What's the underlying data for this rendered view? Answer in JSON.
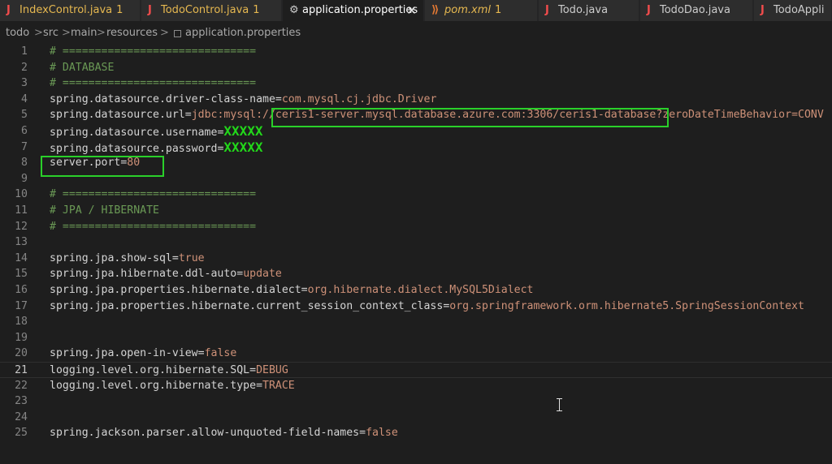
{
  "tabs": [
    {
      "icon": "J",
      "label": "IndexControl.java",
      "badge": "1",
      "icon_color": "#f14c4c",
      "label_color": "#e6b850"
    },
    {
      "icon": "J",
      "label": "TodoControl.java",
      "badge": "1",
      "icon_color": "#f14c4c",
      "label_color": "#e6b850"
    },
    {
      "icon": "⚙",
      "label": "application.properties",
      "badge": "",
      "icon_color": "#cccccc",
      "label_color": "#ffffff",
      "close": "✕"
    },
    {
      "icon": "⟫",
      "label": "pom.xml",
      "badge": "1",
      "icon_color": "#e37933",
      "label_color": "#e6b850"
    },
    {
      "icon": "J",
      "label": "Todo.java",
      "badge": "",
      "icon_color": "#f14c4c",
      "label_color": "#cccccc"
    },
    {
      "icon": "J",
      "label": "TodoDao.java",
      "badge": "",
      "icon_color": "#f14c4c",
      "label_color": "#cccccc"
    },
    {
      "icon": "J",
      "label": "TodoAppli",
      "badge": "",
      "icon_color": "#f14c4c",
      "label_color": "#cccccc"
    }
  ],
  "breadcrumb": [
    "todo",
    "src",
    "main",
    "resources",
    "application.properties"
  ],
  "breadcrumb_sep": ">",
  "lines": [
    {
      "n": "1",
      "comment": "# =============================="
    },
    {
      "n": "2",
      "comment": "# DATABASE"
    },
    {
      "n": "3",
      "comment": "# =============================="
    },
    {
      "n": "4",
      "key": "spring.datasource.driver-class-name",
      "value": "com.mysql.cj.jdbc.Driver"
    },
    {
      "n": "5",
      "key": "spring.datasource.url",
      "value": "jdbc:mysql://ceris1-server.mysql.database.azure.com:3306/ceris1-database?zeroDateTimeBehavior=CONV"
    },
    {
      "n": "6",
      "key": "spring.datasource.username",
      "mask": "XXXXX"
    },
    {
      "n": "7",
      "key": "spring.datasource.password",
      "mask": "XXXXX"
    },
    {
      "n": "8",
      "key": "server.port",
      "value": "80"
    },
    {
      "n": "9"
    },
    {
      "n": "10",
      "comment": "# =============================="
    },
    {
      "n": "11",
      "comment": "# JPA / HIBERNATE"
    },
    {
      "n": "12",
      "comment": "# =============================="
    },
    {
      "n": "13"
    },
    {
      "n": "14",
      "key": "spring.jpa.show-sql",
      "value": "true"
    },
    {
      "n": "15",
      "key": "spring.jpa.hibernate.ddl-auto",
      "value": "update"
    },
    {
      "n": "16",
      "key": "spring.jpa.properties.hibernate.dialect",
      "value": "org.hibernate.dialect.MySQL5Dialect"
    },
    {
      "n": "17",
      "key": "spring.jpa.properties.hibernate.current_session_context_class",
      "value": "org.springframework.orm.hibernate5.SpringSessionContext"
    },
    {
      "n": "18"
    },
    {
      "n": "19"
    },
    {
      "n": "20",
      "key": "spring.jpa.open-in-view",
      "value": "false"
    },
    {
      "n": "21",
      "key": "logging.level.org.hibernate.SQL",
      "value": "DEBUG",
      "current": true
    },
    {
      "n": "22",
      "key": "logging.level.org.hibernate.type",
      "value": "TRACE"
    },
    {
      "n": "23"
    },
    {
      "n": "24"
    },
    {
      "n": "25",
      "key": "spring.jackson.parser.allow-unquoted-field-names",
      "value": "false"
    }
  ]
}
